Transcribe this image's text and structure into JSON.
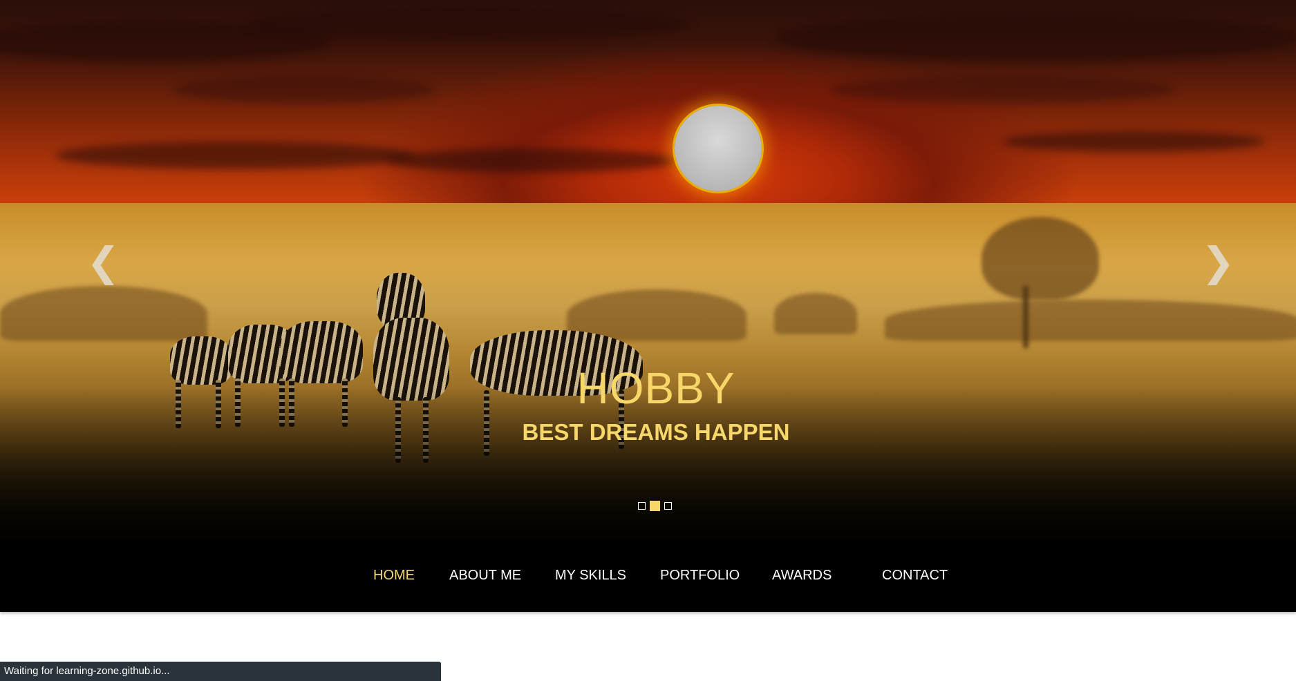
{
  "slider": {
    "title": "HOBBY",
    "subtitle": "BEST DREAMS HAPPEN",
    "prev_arrow": "❮",
    "next_arrow": "❯",
    "slide_count": 3,
    "active_slide": 2
  },
  "nav": {
    "items": [
      {
        "label": "HOME",
        "active": true
      },
      {
        "label": "ABOUT ME",
        "active": false
      },
      {
        "label": "MY SKILLS",
        "active": false
      },
      {
        "label": "PORTFOLIO",
        "active": false
      },
      {
        "label": "AWARDS",
        "active": false
      },
      {
        "label": "CONTACT",
        "active": false
      }
    ]
  },
  "status": {
    "text": "Waiting for learning-zone.github.io..."
  },
  "colors": {
    "accent": "#f7d76a",
    "navbar_bg": "#000000",
    "status_bg": "#2b333a"
  },
  "icons": {
    "prev": "chevron-left-icon",
    "next": "chevron-right-icon"
  }
}
